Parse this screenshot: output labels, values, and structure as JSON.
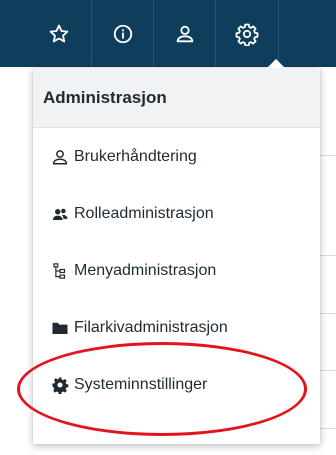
{
  "toolbar": {
    "buttons": [
      {
        "icon": "star-icon"
      },
      {
        "icon": "info-icon"
      },
      {
        "icon": "user-icon"
      },
      {
        "icon": "gear-icon"
      }
    ]
  },
  "menu": {
    "header": "Administrasjon",
    "items": [
      {
        "label": "Brukerhåndtering",
        "icon": "user-outline-icon"
      },
      {
        "label": "Rolleadministrasjon",
        "icon": "users-group-icon"
      },
      {
        "label": "Menyadministrasjon",
        "icon": "sitemap-icon"
      },
      {
        "label": "Filarkivadministrasjon",
        "icon": "folder-icon"
      },
      {
        "label": "Systeminnstillinger",
        "icon": "cog-icon"
      }
    ]
  },
  "colors": {
    "toolbar_bg": "#0f3e5d",
    "menu_header_bg": "#f1f2f4",
    "highlight_ring": "#e3141c",
    "text": "#1f2a33"
  }
}
